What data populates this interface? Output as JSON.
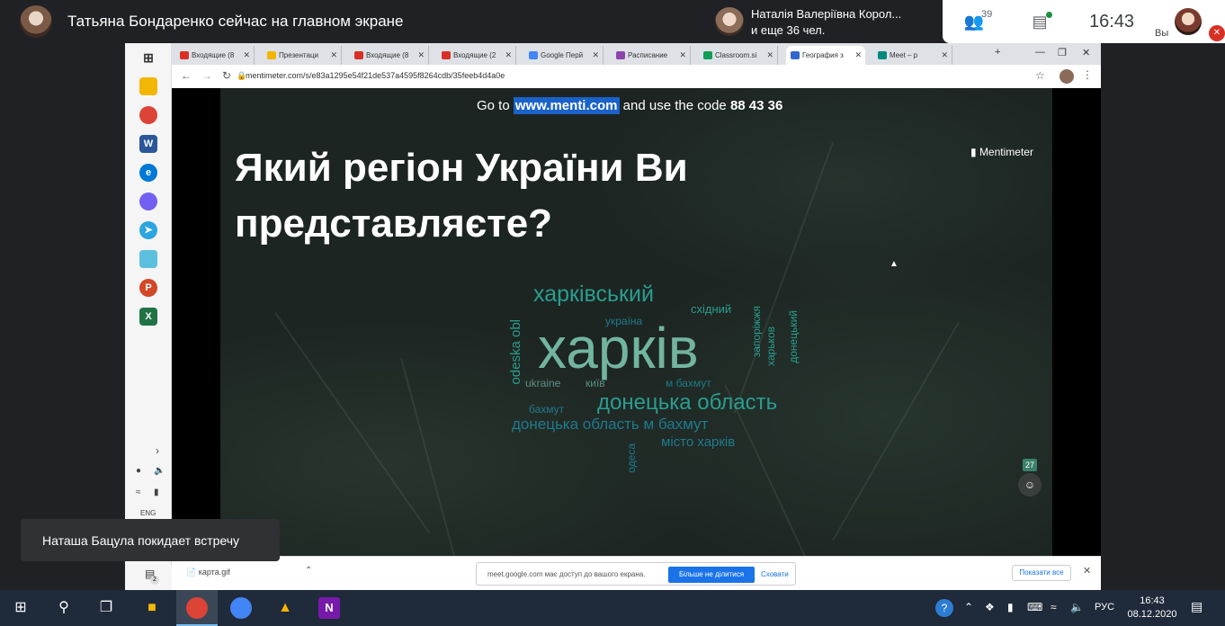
{
  "meet": {
    "presenter_title": "Татьяна Бондаренко сейчас на главном экране",
    "speaker_name": "Наталія Валеріївна Корол...",
    "speaker_others": "и еще 36 чел.",
    "people_count": "39",
    "time": "16:43",
    "self_label": "Вы"
  },
  "browser": {
    "tabs": [
      {
        "label": "Входящие (8",
        "color": "#d93025"
      },
      {
        "label": "Презентаци",
        "color": "#f4b400"
      },
      {
        "label": "Входящие (8",
        "color": "#d93025"
      },
      {
        "label": "Входящие (2",
        "color": "#d93025"
      },
      {
        "label": "Google Перй",
        "color": "#4285f4"
      },
      {
        "label": "Расписание",
        "color": "#8e44ad"
      },
      {
        "label": "Classroom.si",
        "color": "#0f9d58"
      },
      {
        "label": "География з",
        "color": "#3366cc"
      },
      {
        "label": "Meet – p",
        "color": "#00897b"
      }
    ],
    "active_tab_index": 7,
    "url": "mentimeter.com/s/e83a1295e54f21de537a4595f8264cdb/35feeb4d4a0e"
  },
  "slide": {
    "code_prefix": "Go to",
    "site": "www.menti.com",
    "code_mid": "and use the code",
    "code": "88 43 36",
    "brand": "Mentimeter",
    "question": "Який регіон України Ви представляєте?",
    "participants": "27"
  },
  "wordcloud": [
    {
      "text": "харківський",
      "color": "#2a9d8f"
    },
    {
      "text": "україна",
      "color": "#1f7a8c"
    },
    {
      "text": "східний",
      "color": "#2a9d8f"
    },
    {
      "text": "харків",
      "color": "#72b4a0"
    },
    {
      "text": "odeska obl",
      "color": "#2a9d8f"
    },
    {
      "text": "запоріжжя",
      "color": "#2a9d8f"
    },
    {
      "text": "харьков",
      "color": "#2a9d8f"
    },
    {
      "text": "донецький",
      "color": "#2a9d8f"
    },
    {
      "text": "ukraine",
      "color": "#5e8f85"
    },
    {
      "text": "київ",
      "color": "#5e8f85"
    },
    {
      "text": "м бахмут",
      "color": "#1f7a8c"
    },
    {
      "text": "донецька область",
      "color": "#2a9d8f"
    },
    {
      "text": "бахмут",
      "color": "#1f7a8c"
    },
    {
      "text": "донецька область м бахмут",
      "color": "#1f7a8c"
    },
    {
      "text": "місто харків",
      "color": "#1f7a8c"
    },
    {
      "text": "одеса",
      "color": "#1f7a8c"
    }
  ],
  "download_bar": {
    "file": "карта.gif",
    "notice": "meet.google.com має доступ до вашого екрана.",
    "stop_label": "Більше не ділитися",
    "hide_label": "Сховати",
    "show_all": "Показати все"
  },
  "rail": {
    "lang": "ENG",
    "badge": "2"
  },
  "toast": "Наташа Бацула покидает встречу",
  "taskbar": {
    "lang": "РУС",
    "time": "16:43",
    "date": "08.12.2020"
  }
}
